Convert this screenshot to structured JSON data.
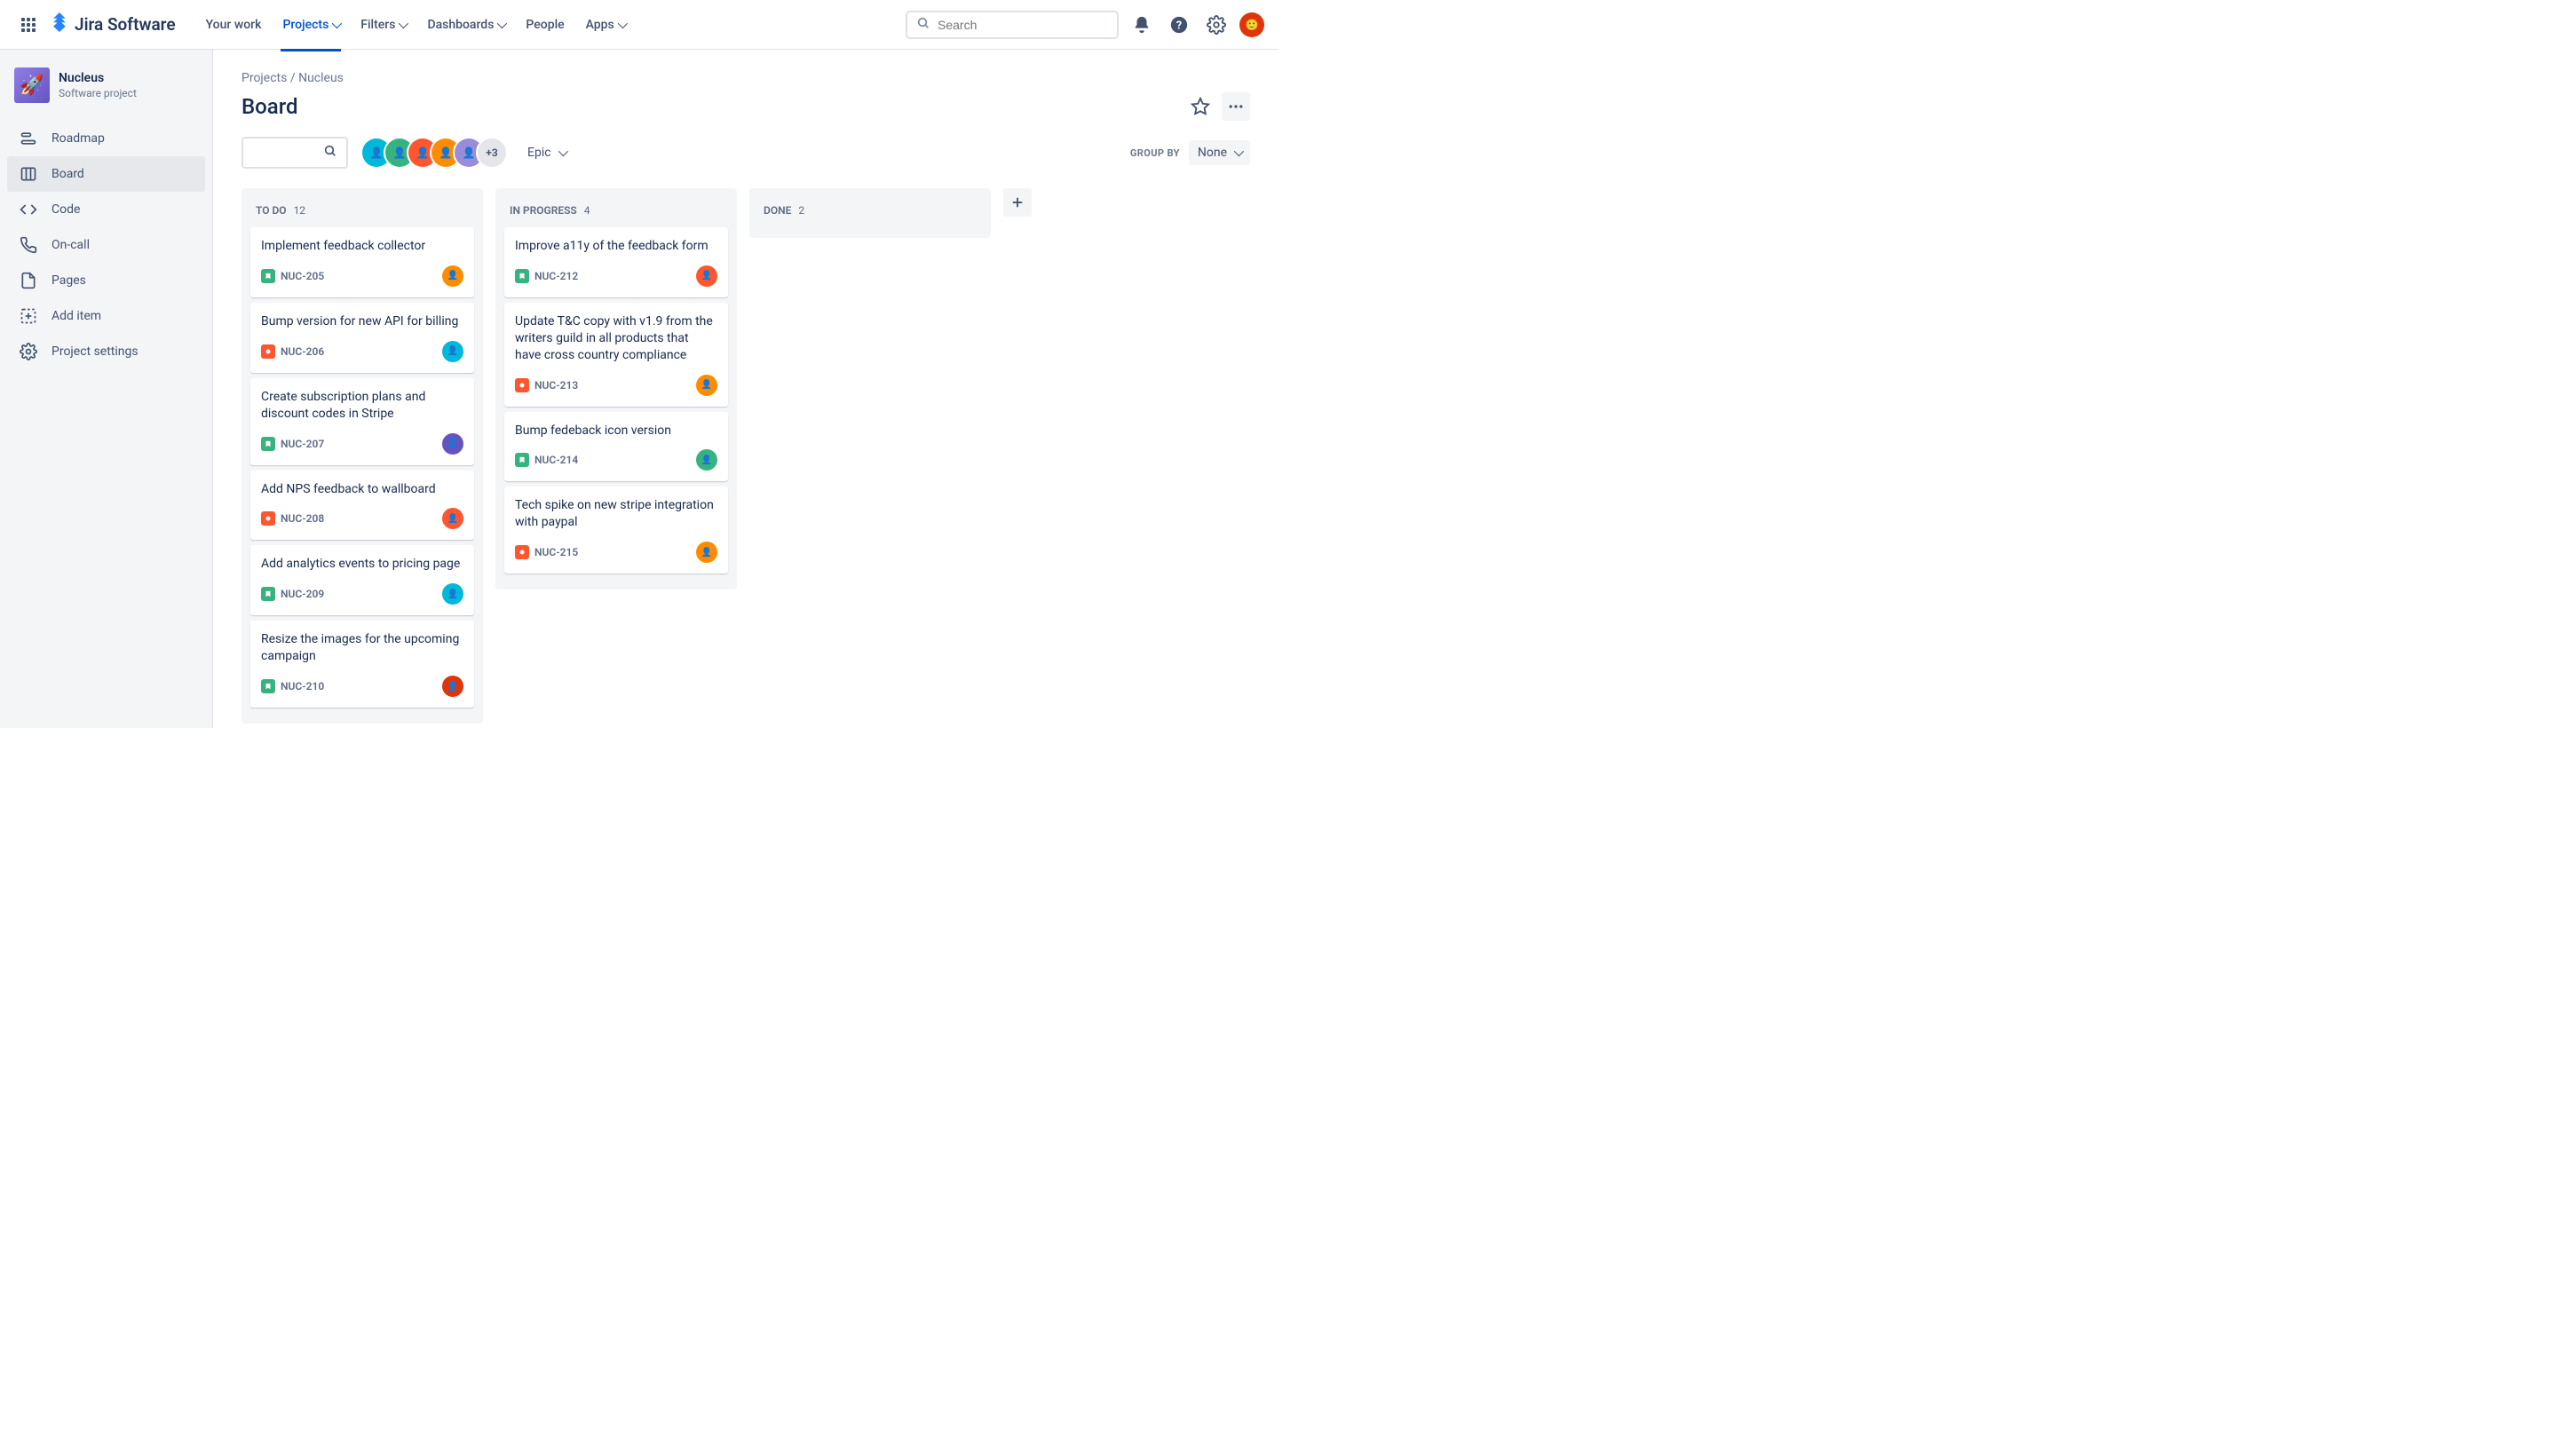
{
  "app": {
    "logo_text": "Jira Software"
  },
  "topnav": {
    "items": [
      {
        "label": "Your work",
        "has_children": false
      },
      {
        "label": "Projects",
        "has_children": true,
        "active": true
      },
      {
        "label": "Filters",
        "has_children": true
      },
      {
        "label": "Dashboards",
        "has_children": true
      },
      {
        "label": "People",
        "has_children": false
      },
      {
        "label": "Apps",
        "has_children": true
      }
    ],
    "search_placeholder": "Search"
  },
  "sidebar": {
    "project_name": "Nucleus",
    "project_type": "Software project",
    "items": [
      {
        "label": "Roadmap",
        "icon": "roadmap"
      },
      {
        "label": "Board",
        "icon": "board",
        "active": true
      },
      {
        "label": "Code",
        "icon": "code"
      },
      {
        "label": "On-call",
        "icon": "oncall"
      },
      {
        "label": "Pages",
        "icon": "pages"
      },
      {
        "label": "Add item",
        "icon": "add"
      },
      {
        "label": "Project settings",
        "icon": "settings"
      }
    ]
  },
  "breadcrumb": {
    "parent": "Projects",
    "current": "Nucleus"
  },
  "page": {
    "title": "Board",
    "epic_label": "Epic",
    "group_by_label": "GROUP BY",
    "group_by_value": "None",
    "avatar_overflow": "+3"
  },
  "columns": [
    {
      "name": "TO DO",
      "count": "12",
      "cards": [
        {
          "title": "Implement feedback collector",
          "key": "NUC-205",
          "type": "story",
          "avatar": "av1"
        },
        {
          "title": "Bump version for new API for billing",
          "key": "NUC-206",
          "type": "bug",
          "avatar": "av2"
        },
        {
          "title": "Create subscription plans and discount codes in Stripe",
          "key": "NUC-207",
          "type": "story",
          "avatar": "av3"
        },
        {
          "title": "Add NPS feedback to wallboard",
          "key": "NUC-208",
          "type": "bug",
          "avatar": "av5"
        },
        {
          "title": "Add analytics events to pricing page",
          "key": "NUC-209",
          "type": "story",
          "avatar": "av2"
        },
        {
          "title": "Resize the images for the upcoming campaign",
          "key": "NUC-210",
          "type": "story",
          "avatar": "av9"
        }
      ]
    },
    {
      "name": "IN PROGRESS",
      "count": "4",
      "cards": [
        {
          "title": "Improve a11y of the feedback form",
          "key": "NUC-212",
          "type": "story",
          "avatar": "av5"
        },
        {
          "title": "Update T&C copy with v1.9 from the writers guild in all products that have cross country compliance",
          "key": "NUC-213",
          "type": "bug",
          "avatar": "av1"
        },
        {
          "title": "Bump fedeback icon version",
          "key": "NUC-214",
          "type": "story",
          "avatar": "av4"
        },
        {
          "title": "Tech spike on new stripe integration with paypal",
          "key": "NUC-215",
          "type": "bug",
          "avatar": "av1"
        }
      ]
    },
    {
      "name": "DONE",
      "count": "2",
      "cards": []
    }
  ]
}
